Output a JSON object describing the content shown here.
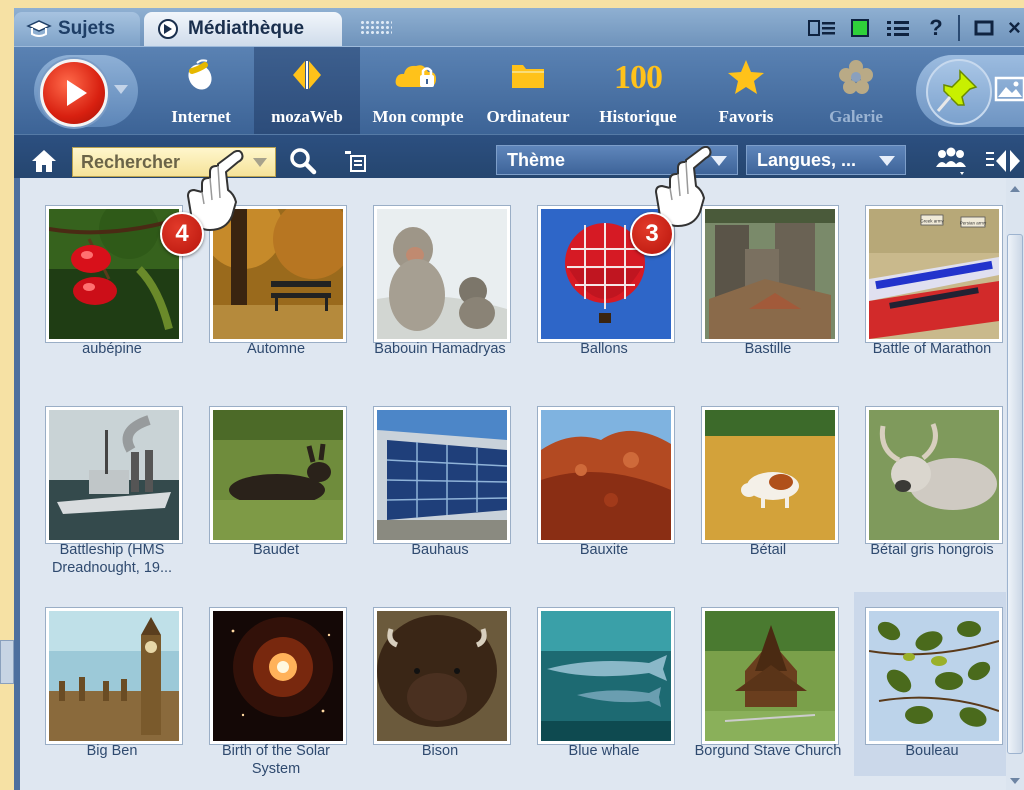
{
  "tabs": [
    {
      "label": "Sujets",
      "active": false
    },
    {
      "label": "Médiathèque",
      "active": true
    }
  ],
  "window_controls": {
    "icons": [
      "view-list-icon",
      "green-square-icon",
      "list-icon",
      "help-icon",
      "maximize-icon",
      "close-icon"
    ],
    "help": "?",
    "close": "×"
  },
  "toolbar": {
    "play": "play-icon",
    "buttons": [
      {
        "label": "Internet",
        "icon": "mouse-icon"
      },
      {
        "label": "mozaWeb",
        "icon": "mozaweb-logo-icon",
        "selected": true
      },
      {
        "label": "Mon compte",
        "icon": "cloud-lock-icon"
      },
      {
        "label": "Ordinateur",
        "icon": "folder-icon"
      },
      {
        "label": "Historique",
        "icon": "100-icon",
        "icon_text": "100"
      },
      {
        "label": "Favoris",
        "icon": "star-icon"
      },
      {
        "label": "Galerie",
        "icon": "flower-icon",
        "disabled": true
      }
    ]
  },
  "searchbar": {
    "placeholder": "Rechercher",
    "theme": "Thème",
    "languages": "Langues, ..."
  },
  "items": [
    {
      "caption": "aubépine"
    },
    {
      "caption": "Automne"
    },
    {
      "caption": "Babouin Hamadryas"
    },
    {
      "caption": "Ballons"
    },
    {
      "caption": "Bastille"
    },
    {
      "caption": "Battle of Marathon",
      "thumb_labels": [
        "Greek army",
        "Persian army"
      ]
    },
    {
      "caption": "Battleship (HMS Dreadnought, 19..."
    },
    {
      "caption": "Baudet"
    },
    {
      "caption": "Bauhaus"
    },
    {
      "caption": "Bauxite"
    },
    {
      "caption": "Bétail"
    },
    {
      "caption": "Bétail gris hongrois"
    },
    {
      "caption": "Big Ben"
    },
    {
      "caption": "Birth of the Solar System"
    },
    {
      "caption": "Bison"
    },
    {
      "caption": "Blue whale"
    },
    {
      "caption": "Borgund Stave Church"
    },
    {
      "caption": "Bouleau",
      "selected": true
    }
  ],
  "callouts": [
    {
      "number": "4"
    },
    {
      "number": "3"
    }
  ],
  "colors": {
    "accent": "#3c6396",
    "callout": "#c8190e",
    "search_bg": "#f5e39a",
    "background": "#f6e1a4"
  }
}
